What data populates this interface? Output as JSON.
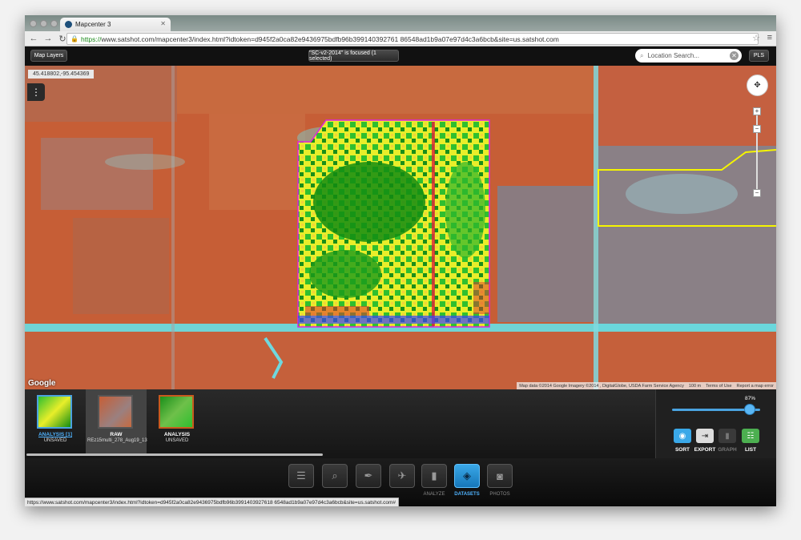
{
  "browser": {
    "tab_title": "Mapcenter 3",
    "url_scheme": "https://",
    "url_rest": "www.satshot.com/mapcenter3/index.html?idtoken=d945f2a0ca82e9436975bdfb96b399140392761 86548ad1b9a07e97d4c3a6bcb&site=us.satshot.com",
    "status_url": "https://www.satshot.com/mapcenter3/index.html?idtoken=d945f2a0ca82e9436975bdfb96b3991403927618 6548ad1b9a07e97d4c3a6bcb&site=us.satshot.com#"
  },
  "header": {
    "map_layers_label": "Map Layers",
    "focus_label": "\"SC-v2-2014\" is focused (1 selected)",
    "search_placeholder": "Location Search...",
    "pls_label": "PLS"
  },
  "map": {
    "coords": "45.418802,-95.454369",
    "google_label": "Google",
    "map_data": "Map data ©2014 Google Imagery ©2014 , DigitalGlobe, USDA Farm Service Agency",
    "scale": "100 m",
    "terms": "Terms of Use",
    "report": "Report a map error"
  },
  "datasets": [
    {
      "title": "ANALYSIS [1]",
      "subtitle": "UNSAVED"
    },
    {
      "title": "RAW",
      "subtitle": "REz15multi_278_Aug19_13"
    },
    {
      "title": "ANALYSIS",
      "subtitle": "UNSAVED"
    }
  ],
  "controls": {
    "opacity": "87%",
    "opacity_value": 0.87,
    "sort": "SORT",
    "export": "EXPORT",
    "graph": "GRAPH",
    "list": "LIST"
  },
  "toolbar": {
    "analyze": "ANALYZE",
    "datasets": "DATASETS",
    "photos": "PHOTOS"
  },
  "colors": {
    "accent": "#3aa8e8",
    "boundary": "#f5f500"
  }
}
